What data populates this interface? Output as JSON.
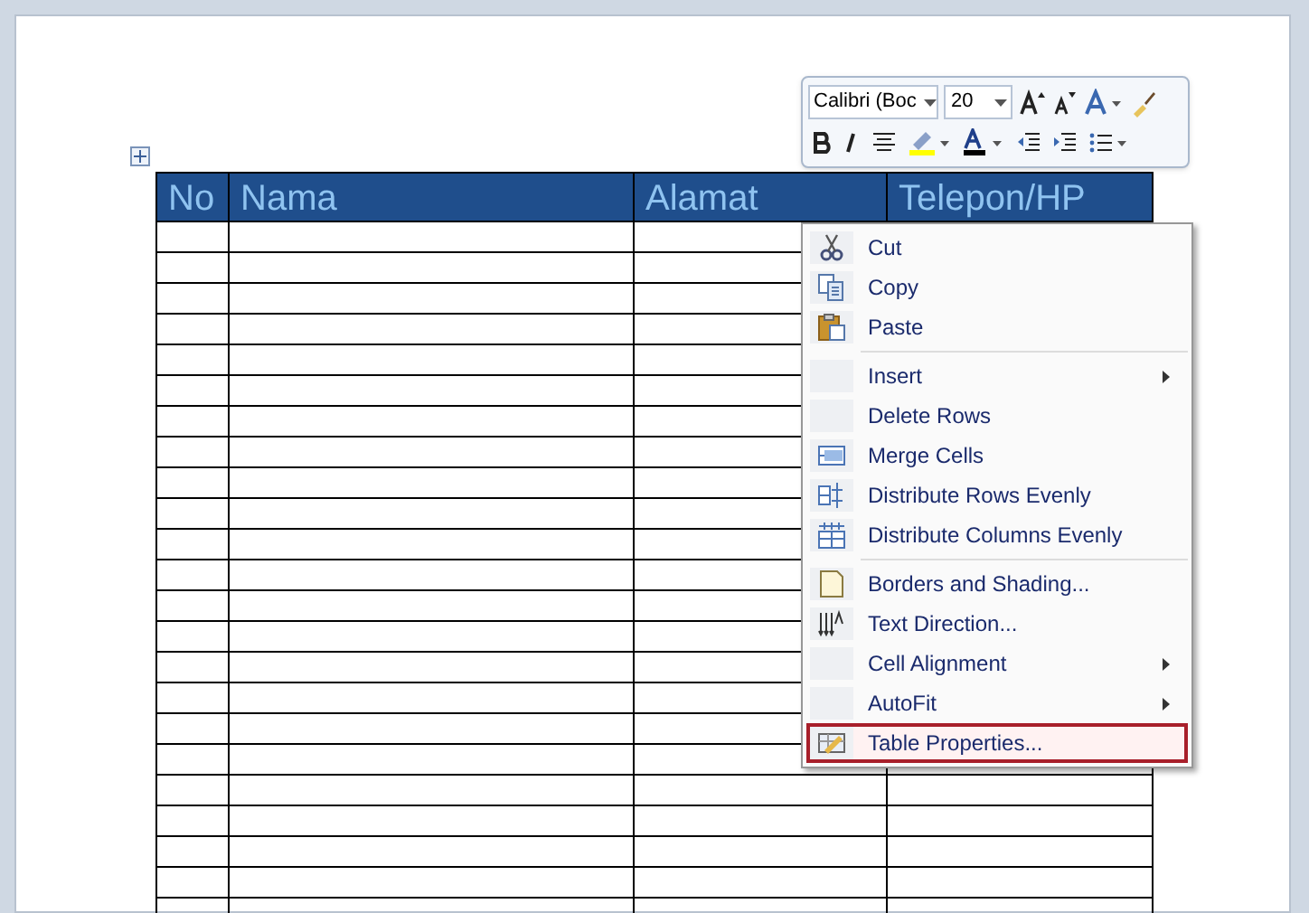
{
  "table": {
    "columns": [
      "No",
      "Nama",
      "Alamat",
      "Telepon/HP"
    ]
  },
  "mini_toolbar": {
    "font": "Calibri (Boc",
    "size": "20"
  },
  "context_menu": {
    "groups": [
      [
        {
          "label": "Cut",
          "submenu": false,
          "selected": false
        },
        {
          "label": "Copy",
          "submenu": false,
          "selected": false
        },
        {
          "label": "Paste",
          "submenu": false,
          "selected": false
        }
      ],
      [
        {
          "label": "Insert",
          "submenu": true,
          "selected": false
        },
        {
          "label": "Delete Rows",
          "submenu": false,
          "selected": false
        },
        {
          "label": "Merge Cells",
          "submenu": false,
          "selected": false
        },
        {
          "label": "Distribute Rows Evenly",
          "submenu": false,
          "selected": false
        },
        {
          "label": "Distribute Columns Evenly",
          "submenu": false,
          "selected": false
        }
      ],
      [
        {
          "label": "Borders and Shading...",
          "submenu": false,
          "selected": false
        },
        {
          "label": "Text Direction...",
          "submenu": false,
          "selected": false
        },
        {
          "label": "Cell Alignment",
          "submenu": true,
          "selected": false
        },
        {
          "label": "AutoFit",
          "submenu": true,
          "selected": false
        },
        {
          "label": "Table Properties...",
          "submenu": false,
          "selected": true
        }
      ]
    ]
  }
}
